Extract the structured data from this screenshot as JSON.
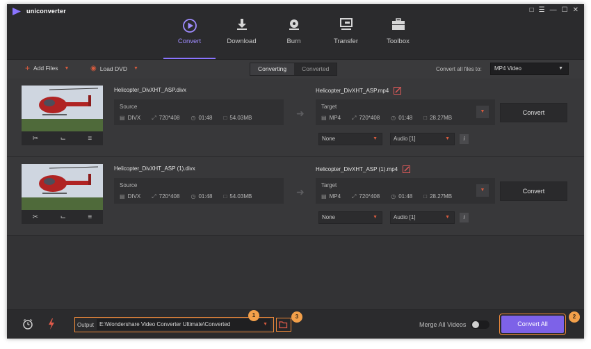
{
  "app": {
    "title": "uniconverter"
  },
  "window_controls": [
    "feedback-icon",
    "menu-icon",
    "minimize-icon",
    "maximize-icon",
    "close-icon"
  ],
  "nav": {
    "items": [
      {
        "label": "Convert",
        "icon": "convert-icon",
        "active": true
      },
      {
        "label": "Download",
        "icon": "download-icon",
        "active": false
      },
      {
        "label": "Burn",
        "icon": "burn-icon",
        "active": false
      },
      {
        "label": "Transfer",
        "icon": "transfer-icon",
        "active": false
      },
      {
        "label": "Toolbox",
        "icon": "toolbox-icon",
        "active": false
      }
    ]
  },
  "toolbar": {
    "add_files": "Add Files",
    "load_dvd": "Load DVD",
    "tab_converting": "Converting",
    "tab_converted": "Converted",
    "convert_all_to_label": "Convert all files to:",
    "format_value": "MP4 Video"
  },
  "files": [
    {
      "source_name": "Helicopter_DivXHT_ASP.divx",
      "source_label": "Source",
      "source_format": "DIVX",
      "source_resolution": "720*408",
      "source_duration": "01:48",
      "source_size": "54.03MB",
      "target_name": "Helicopter_DivXHT_ASP.mp4",
      "target_label": "Target",
      "target_format": "MP4",
      "target_resolution": "720*408",
      "target_duration": "01:48",
      "target_size": "28.27MB",
      "convert_label": "Convert",
      "subtitle": "None",
      "audio": "Audio [1]"
    },
    {
      "source_name": "Helicopter_DivXHT_ASP (1).divx",
      "source_label": "Source",
      "source_format": "DIVX",
      "source_resolution": "720*408",
      "source_duration": "01:48",
      "source_size": "54.03MB",
      "target_name": "Helicopter_DivXHT_ASP (1).mp4",
      "target_label": "Target",
      "target_format": "MP4",
      "target_resolution": "720*408",
      "target_duration": "01:48",
      "target_size": "28.27MB",
      "convert_label": "Convert",
      "subtitle": "None",
      "audio": "Audio [1]"
    }
  ],
  "bottom": {
    "output_label": "Output",
    "output_path": "E:\\Wondershare Video Converter Ultimate\\Converted",
    "merge_label": "Merge All Videos",
    "merge_on": false,
    "convert_all": "Convert All"
  },
  "callouts": [
    "1",
    "2",
    "3"
  ],
  "colors": {
    "accent": "#7d62e8",
    "highlight": "#ef8a3a",
    "badge": "#f3a04a",
    "caret": "#d85b3e"
  }
}
